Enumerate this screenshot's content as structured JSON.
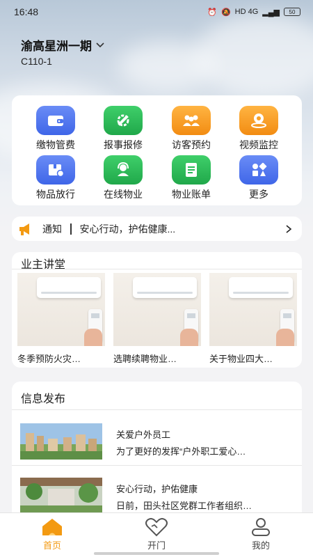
{
  "status_bar": {
    "time": "16:48",
    "network": "HD 4G",
    "battery": "50"
  },
  "header": {
    "community": "渝高星洲一期",
    "room": "C110-1"
  },
  "services": [
    {
      "label": "缴物管费",
      "icon": "wallet-icon",
      "color": "#4a72ee"
    },
    {
      "label": "报事报修",
      "icon": "wrench-icon",
      "color": "#28b856"
    },
    {
      "label": "访客预约",
      "icon": "visitors-icon",
      "color": "#f7a128"
    },
    {
      "label": "视频监控",
      "icon": "camera-icon",
      "color": "#f7a128"
    },
    {
      "label": "物品放行",
      "icon": "package-icon",
      "color": "#4a72ee"
    },
    {
      "label": "在线物业",
      "icon": "service-agent-icon",
      "color": "#28b856"
    },
    {
      "label": "物业账单",
      "icon": "bill-icon",
      "color": "#28b856"
    },
    {
      "label": "更多",
      "icon": "more-icon",
      "color": "#4a72ee"
    }
  ],
  "notice": {
    "tag": "通知",
    "text": "安心行动，护佑健康..."
  },
  "lectures": {
    "title": "业主讲堂",
    "items": [
      {
        "caption": "冬季预防火灾…"
      },
      {
        "caption": "选聘续聘物业…"
      },
      {
        "caption": "关于物业四大…"
      }
    ]
  },
  "info": {
    "title": "信息发布",
    "items": [
      {
        "title": "关爱户外员工",
        "summary": "为了更好的发挥“户外职工爱心…"
      },
      {
        "title": "安心行动，护佑健康",
        "summary": "日前，田头社区党群工作者组织…"
      }
    ]
  },
  "tabs": [
    {
      "label": "首页",
      "icon": "home-icon",
      "active": true
    },
    {
      "label": "开门",
      "icon": "heart-icon",
      "active": false
    },
    {
      "label": "我的",
      "icon": "profile-icon",
      "active": false
    }
  ],
  "colors": {
    "accent": "#f39a12",
    "blue": "#4a72ee",
    "green": "#28b856",
    "orange": "#f7a128"
  }
}
